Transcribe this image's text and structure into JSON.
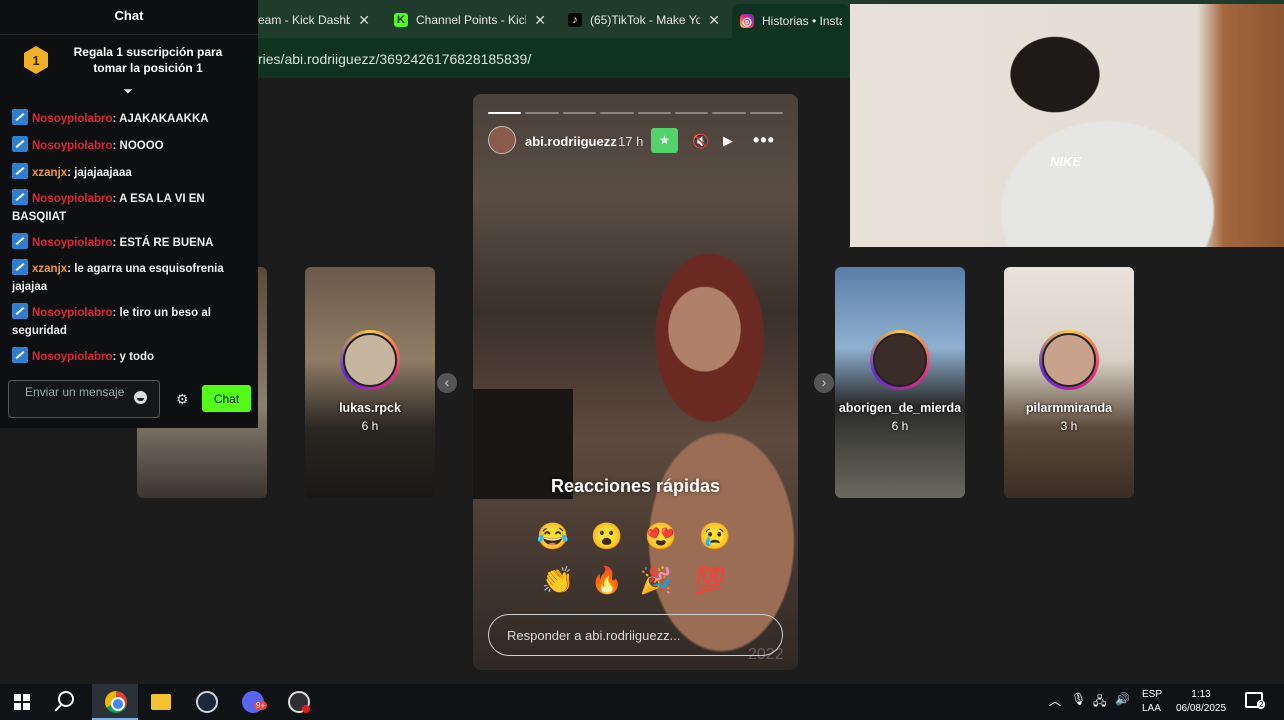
{
  "browser": {
    "tabs": [
      {
        "label": "eam - Kick Dashbo",
        "favicon": "kick-dashboard-icon"
      },
      {
        "label": "Channel Points - Kick",
        "favicon": "kick-logo-icon"
      },
      {
        "label": "(65)TikTok - Make Yo",
        "favicon": "tiktok-icon"
      },
      {
        "label": "Historias • Instagra",
        "favicon": "instagram-icon"
      }
    ],
    "url": "ries/abi.rodriiguezz/3692426176828185839/",
    "colors": {
      "tabbar": "#1f3b2c",
      "addressbar": "#0f3321"
    }
  },
  "chat": {
    "title": "Chat",
    "gift_rank": "1",
    "gift_text": "Regala 1 suscripción para tomar la posición 1",
    "messages": [
      {
        "user": "Nosoypiolabro",
        "text": ": AJAKAKAAKKA",
        "color": "#e0233a"
      },
      {
        "user": "Nosoypiolabro",
        "text": ": NOOOO",
        "color": "#e0233a"
      },
      {
        "user": "xzanjx",
        "text": ": jajajaajaaa",
        "color": "#f39a1e"
      },
      {
        "user": "Nosoypiolabro",
        "text": ": A ESA LA VI EN BASQIIAT",
        "color": "#e0233a"
      },
      {
        "user": "Nosoypiolabro",
        "text": ": ESTÁ RE BUENA",
        "color": "#e0233a"
      },
      {
        "user": "xzanjx",
        "text": ": le agarra una esquisofrenia jajajaa",
        "color": "#f39a1e"
      },
      {
        "user": "Nosoypiolabro",
        "text": ": le tiro un beso al seguridad",
        "color": "#e0233a"
      },
      {
        "user": "Nosoypiolabro",
        "text": ": y todo",
        "color": "#e0233a"
      }
    ],
    "input_placeholder": "Enviar un mensaje",
    "send_label": "Chat",
    "accent": "#53fc18"
  },
  "stories": {
    "side": [
      {
        "name": "lukas.rpck",
        "time": "6 h"
      },
      {
        "name": "aborigen_de_mierda",
        "time": "6 h"
      },
      {
        "name": "pilarmmiranda",
        "time": "3 h"
      }
    ],
    "main": {
      "user": "abi.rodriiguezz",
      "time": "17 h",
      "quick_reactions_title": "Reacciones rápidas",
      "emojis": [
        "😂",
        "😮",
        "😍",
        "😢",
        "👏",
        "🔥",
        "🎉",
        "💯"
      ],
      "reply_placeholder": "Responder a abi.rodriiguezz...",
      "watermark": "2022",
      "segments_total": 8,
      "segment_active": 1
    }
  },
  "webcam": {
    "shirt_logo": "NIKE"
  },
  "taskbar": {
    "lang_1": "ESP",
    "lang_2": "LAA",
    "time": "1:13",
    "date": "06/08/2025",
    "discord_badge": "9+",
    "notifications": "2"
  }
}
